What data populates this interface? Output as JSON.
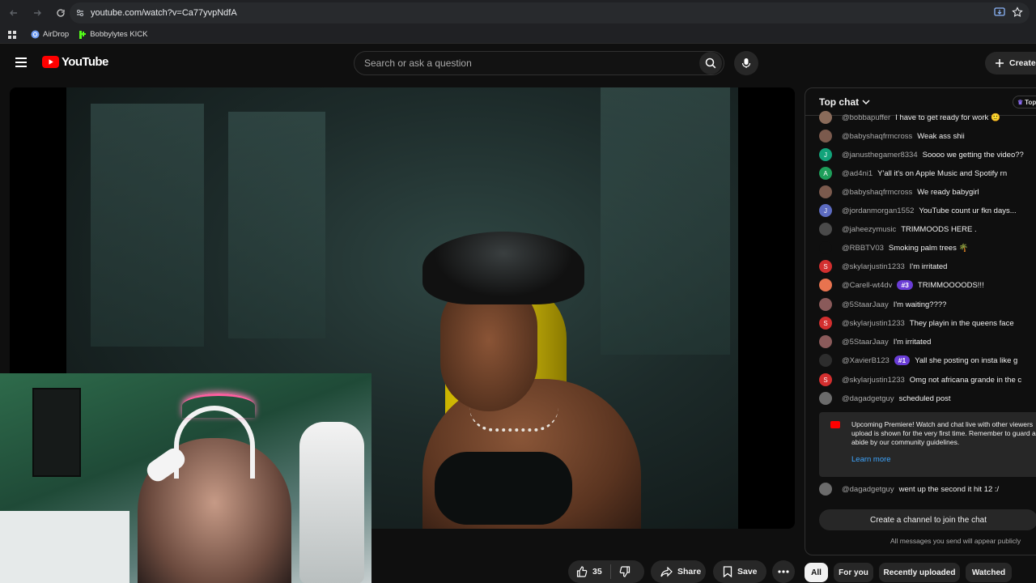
{
  "browser": {
    "url": "youtube.com/watch?v=Ca77yvpNdfA",
    "bookmarks": [
      {
        "label": "AirDrop",
        "icon": "airdrop-icon"
      },
      {
        "label": "Bobbylytes KICK",
        "icon": "kick-icon"
      }
    ]
  },
  "header": {
    "logo_text": "YouTube",
    "search_placeholder": "Search or ask a question",
    "create_label": "Create"
  },
  "actions": {
    "like_count": "35",
    "share_label": "Share",
    "save_label": "Save"
  },
  "chat": {
    "title": "Top chat",
    "top_badge": "Top",
    "messages": [
      {
        "author": "@bobbapuffer",
        "text": "I have to get ready for work 🙂",
        "avatar_color": "#8a6b5a",
        "initial": ""
      },
      {
        "author": "@babyshaqfrmcross",
        "text": "Weak ass shii",
        "avatar_color": "#7b5a4d",
        "initial": ""
      },
      {
        "author": "@janusthegamer8334",
        "text": "Soooo we getting the video??",
        "avatar_color": "#12a37a",
        "initial": "J"
      },
      {
        "author": "@ad4ni1",
        "text": "Y'all it's on Apple Music and Spotify rn",
        "avatar_color": "#1e9e5a",
        "initial": "A"
      },
      {
        "author": "@babyshaqfrmcross",
        "text": "We ready babygirl",
        "avatar_color": "#7b5a4d",
        "initial": ""
      },
      {
        "author": "@jordanmorgan1552",
        "text": "YouTube count ur fkn days...",
        "avatar_color": "#5c6bc0",
        "initial": "J"
      },
      {
        "author": "@jaheezymusic",
        "text": "TRIMMOODS HERE .",
        "avatar_color": "#4a4a4a",
        "initial": ""
      },
      {
        "author": "@RBBTV03",
        "text": "Smoking palm trees 🌴",
        "avatar_color": "#0f0f0f",
        "initial": ""
      },
      {
        "author": "@skylarjustin1233",
        "text": "I'm irritated",
        "avatar_color": "#d32f2f",
        "initial": "S"
      },
      {
        "author": "@Carell-wt4dv",
        "text": "TRIMMOOOODS!!!",
        "avatar_color": "#e8734f",
        "initial": "",
        "rank": "#3"
      },
      {
        "author": "@5StaarJaay",
        "text": "I'm waiting????",
        "avatar_color": "#8a5a5a",
        "initial": ""
      },
      {
        "author": "@skylarjustin1233",
        "text": "They playin in the queens face",
        "avatar_color": "#d32f2f",
        "initial": "S"
      },
      {
        "author": "@5StaarJaay",
        "text": "I'm irritated",
        "avatar_color": "#8a5a5a",
        "initial": ""
      },
      {
        "author": "@XavierB123",
        "text": "Yall she posting on insta like g",
        "avatar_color": "#2d2d2d",
        "initial": "",
        "rank": "#1"
      },
      {
        "author": "@skylarjustin1233",
        "text": "Omg not africana grande in the c",
        "avatar_color": "#d32f2f",
        "initial": "S"
      },
      {
        "author": "@dagadgetguy",
        "text": "scheduled post",
        "avatar_color": "#6b6b6b",
        "initial": ""
      }
    ],
    "premiere_text": "Upcoming Premiere! Watch and chat live with other viewers upload is shown for the very first time. Remember to guard and abide by our community guidelines.",
    "learn_more": "Learn more",
    "last_message": {
      "author": "@dagadgetguy",
      "text": "went up the second it hit 12 :/",
      "avatar_color": "#6b6b6b"
    },
    "join_label": "Create a channel to join the chat",
    "public_note": "All messages you send will appear publicly"
  },
  "chips": [
    "All",
    "For you",
    "Recently uploaded",
    "Watched"
  ]
}
